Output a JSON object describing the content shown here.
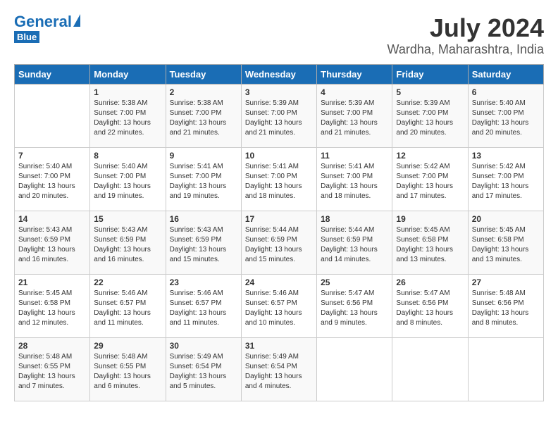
{
  "header": {
    "logo_general": "General",
    "logo_blue": "Blue",
    "month": "July 2024",
    "location": "Wardha, Maharashtra, India"
  },
  "weekdays": [
    "Sunday",
    "Monday",
    "Tuesday",
    "Wednesday",
    "Thursday",
    "Friday",
    "Saturday"
  ],
  "weeks": [
    [
      {
        "day": "",
        "info": ""
      },
      {
        "day": "1",
        "info": "Sunrise: 5:38 AM\nSunset: 7:00 PM\nDaylight: 13 hours\nand 22 minutes."
      },
      {
        "day": "2",
        "info": "Sunrise: 5:38 AM\nSunset: 7:00 PM\nDaylight: 13 hours\nand 21 minutes."
      },
      {
        "day": "3",
        "info": "Sunrise: 5:39 AM\nSunset: 7:00 PM\nDaylight: 13 hours\nand 21 minutes."
      },
      {
        "day": "4",
        "info": "Sunrise: 5:39 AM\nSunset: 7:00 PM\nDaylight: 13 hours\nand 21 minutes."
      },
      {
        "day": "5",
        "info": "Sunrise: 5:39 AM\nSunset: 7:00 PM\nDaylight: 13 hours\nand 20 minutes."
      },
      {
        "day": "6",
        "info": "Sunrise: 5:40 AM\nSunset: 7:00 PM\nDaylight: 13 hours\nand 20 minutes."
      }
    ],
    [
      {
        "day": "7",
        "info": "Sunrise: 5:40 AM\nSunset: 7:00 PM\nDaylight: 13 hours\nand 20 minutes."
      },
      {
        "day": "8",
        "info": "Sunrise: 5:40 AM\nSunset: 7:00 PM\nDaylight: 13 hours\nand 19 minutes."
      },
      {
        "day": "9",
        "info": "Sunrise: 5:41 AM\nSunset: 7:00 PM\nDaylight: 13 hours\nand 19 minutes."
      },
      {
        "day": "10",
        "info": "Sunrise: 5:41 AM\nSunset: 7:00 PM\nDaylight: 13 hours\nand 18 minutes."
      },
      {
        "day": "11",
        "info": "Sunrise: 5:41 AM\nSunset: 7:00 PM\nDaylight: 13 hours\nand 18 minutes."
      },
      {
        "day": "12",
        "info": "Sunrise: 5:42 AM\nSunset: 7:00 PM\nDaylight: 13 hours\nand 17 minutes."
      },
      {
        "day": "13",
        "info": "Sunrise: 5:42 AM\nSunset: 7:00 PM\nDaylight: 13 hours\nand 17 minutes."
      }
    ],
    [
      {
        "day": "14",
        "info": "Sunrise: 5:43 AM\nSunset: 6:59 PM\nDaylight: 13 hours\nand 16 minutes."
      },
      {
        "day": "15",
        "info": "Sunrise: 5:43 AM\nSunset: 6:59 PM\nDaylight: 13 hours\nand 16 minutes."
      },
      {
        "day": "16",
        "info": "Sunrise: 5:43 AM\nSunset: 6:59 PM\nDaylight: 13 hours\nand 15 minutes."
      },
      {
        "day": "17",
        "info": "Sunrise: 5:44 AM\nSunset: 6:59 PM\nDaylight: 13 hours\nand 15 minutes."
      },
      {
        "day": "18",
        "info": "Sunrise: 5:44 AM\nSunset: 6:59 PM\nDaylight: 13 hours\nand 14 minutes."
      },
      {
        "day": "19",
        "info": "Sunrise: 5:45 AM\nSunset: 6:58 PM\nDaylight: 13 hours\nand 13 minutes."
      },
      {
        "day": "20",
        "info": "Sunrise: 5:45 AM\nSunset: 6:58 PM\nDaylight: 13 hours\nand 13 minutes."
      }
    ],
    [
      {
        "day": "21",
        "info": "Sunrise: 5:45 AM\nSunset: 6:58 PM\nDaylight: 13 hours\nand 12 minutes."
      },
      {
        "day": "22",
        "info": "Sunrise: 5:46 AM\nSunset: 6:57 PM\nDaylight: 13 hours\nand 11 minutes."
      },
      {
        "day": "23",
        "info": "Sunrise: 5:46 AM\nSunset: 6:57 PM\nDaylight: 13 hours\nand 11 minutes."
      },
      {
        "day": "24",
        "info": "Sunrise: 5:46 AM\nSunset: 6:57 PM\nDaylight: 13 hours\nand 10 minutes."
      },
      {
        "day": "25",
        "info": "Sunrise: 5:47 AM\nSunset: 6:56 PM\nDaylight: 13 hours\nand 9 minutes."
      },
      {
        "day": "26",
        "info": "Sunrise: 5:47 AM\nSunset: 6:56 PM\nDaylight: 13 hours\nand 8 minutes."
      },
      {
        "day": "27",
        "info": "Sunrise: 5:48 AM\nSunset: 6:56 PM\nDaylight: 13 hours\nand 8 minutes."
      }
    ],
    [
      {
        "day": "28",
        "info": "Sunrise: 5:48 AM\nSunset: 6:55 PM\nDaylight: 13 hours\nand 7 minutes."
      },
      {
        "day": "29",
        "info": "Sunrise: 5:48 AM\nSunset: 6:55 PM\nDaylight: 13 hours\nand 6 minutes."
      },
      {
        "day": "30",
        "info": "Sunrise: 5:49 AM\nSunset: 6:54 PM\nDaylight: 13 hours\nand 5 minutes."
      },
      {
        "day": "31",
        "info": "Sunrise: 5:49 AM\nSunset: 6:54 PM\nDaylight: 13 hours\nand 4 minutes."
      },
      {
        "day": "",
        "info": ""
      },
      {
        "day": "",
        "info": ""
      },
      {
        "day": "",
        "info": ""
      }
    ]
  ]
}
